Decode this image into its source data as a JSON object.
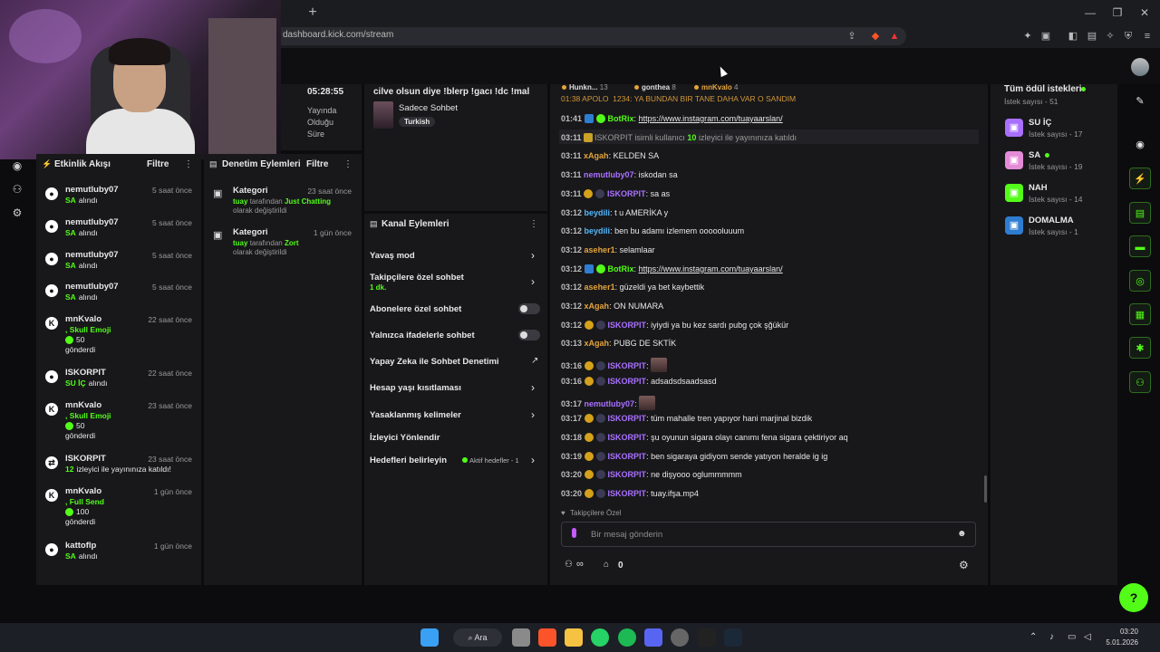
{
  "browser": {
    "url": "dashboard.kick.com/stream",
    "new_tab": "+",
    "win_min": "—",
    "win_max": "❐",
    "win_close": "✕"
  },
  "uptime": {
    "time": "05:28:55",
    "label_1": "Yayında",
    "label_2": "Olduğu",
    "label_3": "Süre"
  },
  "stream_info": {
    "title": "cilve olsun diye !blerp !gacı !dc !mal",
    "category": "Sadece Sohbet",
    "language": "Turkish"
  },
  "top_users_strip": [
    {
      "name": "Hunkn...",
      "count": "13"
    },
    {
      "name": "gonthea",
      "count": "8"
    },
    {
      "name": "mnKvalo",
      "count": "4"
    }
  ],
  "activity": {
    "title": "Etkinlik Akışı",
    "filter": "Filtre",
    "items": [
      {
        "name": "nemutluby07",
        "time": "5 saat önce",
        "detail_strong": "SA",
        "detail": "alındı",
        "icon": "kick-icon"
      },
      {
        "name": "nemutluby07",
        "time": "5 saat önce",
        "detail_strong": "SA",
        "detail": "alındı",
        "icon": "kick-icon"
      },
      {
        "name": "nemutluby07",
        "time": "5 saat önce",
        "detail_strong": "SA",
        "detail": "alındı",
        "icon": "kick-icon"
      },
      {
        "name": "nemutluby07",
        "time": "5 saat önce",
        "detail_strong": "SA",
        "detail": "alındı",
        "icon": "kick-icon"
      },
      {
        "name": "mnKvalo",
        "time": "22 saat önce",
        "detail_strong": ", Skull Emoji",
        "amount": "50",
        "detail": "gönderdi",
        "icon": "k-icon"
      },
      {
        "name": "ISKORPIT",
        "time": "22 saat önce",
        "detail_strong": "SU İÇ",
        "detail": "alındı",
        "icon": "kick-icon"
      },
      {
        "name": "mnKvalo",
        "time": "23 saat önce",
        "detail_strong": ", Skull Emoji",
        "amount": "50",
        "detail": "gönderdi",
        "icon": "k-icon"
      },
      {
        "name": "ISKORPIT",
        "time": "23 saat önce",
        "detail_strong": "12",
        "detail": "izleyici ile yayınınıza katıldı!",
        "icon": "raid-icon"
      },
      {
        "name": "mnKvalo",
        "time": "1 gün önce",
        "detail_strong": ", Full Send",
        "amount": "100",
        "detail": "gönderdi",
        "icon": "k-icon"
      },
      {
        "name": "kattoflp",
        "time": "1 gün önce",
        "detail_strong": "SA",
        "detail": "alındı",
        "icon": "kick-icon"
      }
    ]
  },
  "moderation": {
    "title": "Denetim Eylemleri",
    "filter": "Filtre",
    "items": [
      {
        "title": "Kategori",
        "time": "23 saat önce",
        "actor": "tuay",
        "mid": "tarafından",
        "value": "Just Chatting",
        "tail": "olarak değiştirildi"
      },
      {
        "title": "Kategori",
        "time": "1 gün önce",
        "actor": "tuay",
        "mid": "tarafından",
        "value": "Zort",
        "tail": "olarak değiştirildi"
      }
    ]
  },
  "channel_actions": {
    "title": "Kanal Eylemleri",
    "slow_mode": "Yavaş mod",
    "followers_only": "Takipçilere özel sohbet",
    "followers_only_value": "1 dk.",
    "subs_only": "Abonelere özel sohbet",
    "emotes_only": "Yalnızca ifadelerle sohbet",
    "ai_moderation": "Yapay Zeka ile Sohbet Denetimi",
    "age_restriction": "Hesap yaşı kısıtlaması",
    "banned_words": "Yasaklanmış kelimeler",
    "viewer_redirect": "İzleyici Yönlendir",
    "goals": "Hedefleri belirleyin",
    "goals_status": "Aktif hedefler - 1"
  },
  "chat": {
    "partial_top": "01:38  APOLO_1234: YA BUNDAN BIR TANE DAHA VAR O SANDIM",
    "messages": [
      {
        "time": "01:41",
        "user": "BotRix",
        "color": "#53fc18",
        "badges": [
          "bot",
          "verified"
        ],
        "text": "https://www.instagram.com/tuayaarslan/",
        "link": true
      },
      {
        "time": "03:11",
        "system": true,
        "text_1": "ISKORPIT isimli kullanıcı",
        "num": "10",
        "text_2": "izleyici ile yayınınıza katıldı"
      },
      {
        "time": "03:11",
        "user": "xAgah",
        "color": "#e3a43a",
        "badges": [],
        "text": "KELDEN SA"
      },
      {
        "time": "03:11",
        "user": "nemutluby07",
        "color": "#a970ff",
        "badges": [],
        "text": "iskodan sa"
      },
      {
        "time": "03:11",
        "user": "ISKORPIT",
        "color": "#a970ff",
        "badges": [
          "gold",
          "moon"
        ],
        "text": "sa as"
      },
      {
        "time": "03:12",
        "user": "beydili",
        "color": "#53b7fc",
        "badges": [],
        "text": "t u AMERİKA y"
      },
      {
        "time": "03:12",
        "user": "beydili",
        "color": "#53b7fc",
        "badges": [],
        "text": "ben bu adamı izlemem oooooluuum"
      },
      {
        "time": "03:12",
        "user": "aseher1",
        "color": "#e3a43a",
        "badges": [],
        "text": "selamlaar"
      },
      {
        "time": "03:12",
        "user": "BotRix",
        "color": "#53fc18",
        "badges": [
          "bot",
          "verified"
        ],
        "text": "https://www.instagram.com/tuayaarslan/",
        "link": true
      },
      {
        "time": "03:12",
        "user": "aseher1",
        "color": "#e3a43a",
        "badges": [],
        "text": "güzeldi ya bet kaybettik"
      },
      {
        "time": "03:12",
        "user": "xAgah",
        "color": "#e3a43a",
        "badges": [],
        "text": "ON NUMARA"
      },
      {
        "time": "03:12",
        "user": "ISKORPIT",
        "color": "#a970ff",
        "badges": [
          "gold",
          "moon"
        ],
        "text": "iyiydi ya bu kez sardı pubg çok şğükür"
      },
      {
        "time": "03:13",
        "user": "xAgah",
        "color": "#e3a43a",
        "badges": [],
        "text": "PUBG DE SKTİK"
      },
      {
        "time": "03:16",
        "user": "ISKORPIT",
        "color": "#a970ff",
        "badges": [
          "gold",
          "moon"
        ],
        "text": "",
        "emote": true
      },
      {
        "time": "03:16",
        "user": "ISKORPIT",
        "color": "#a970ff",
        "badges": [
          "gold",
          "moon"
        ],
        "text": "adsadsdsaadsasd"
      },
      {
        "time": "03:17",
        "user": "nemutluby07",
        "color": "#a970ff",
        "badges": [],
        "text": "",
        "emote": true
      },
      {
        "time": "03:17",
        "user": "ISKORPIT",
        "color": "#a970ff",
        "badges": [
          "gold",
          "moon"
        ],
        "text": "tüm mahalle tren yapıyor hani marjinal bizdik"
      },
      {
        "time": "03:18",
        "user": "ISKORPIT",
        "color": "#a970ff",
        "badges": [
          "gold",
          "moon"
        ],
        "text": "şu oyunun sigara olayı canımı fena sigara çektiriyor aq"
      },
      {
        "time": "03:19",
        "user": "ISKORPIT",
        "color": "#a970ff",
        "badges": [
          "gold",
          "moon"
        ],
        "text": "ben sigaraya gidiyom sende yatıyon heralde ig ig"
      },
      {
        "time": "03:20",
        "user": "ISKORPIT",
        "color": "#a970ff",
        "badges": [
          "gold",
          "moon"
        ],
        "text": "ne dişyooo oglummmmm"
      },
      {
        "time": "03:20",
        "user": "ISKORPIT",
        "color": "#a970ff",
        "badges": [
          "gold",
          "moon"
        ],
        "text": "tuay.ifşa.mp4"
      }
    ],
    "mode_label": "Takipçilere Özel",
    "input_placeholder": "Bir mesaj gönderin",
    "viewer_count": "∞",
    "points": "0"
  },
  "rewards": {
    "title": "Tüm ödül istekleri",
    "items": [
      {
        "name": "SU İÇ",
        "count": "İstek sayısı - 17",
        "color": "#a970ff",
        "dot": false
      },
      {
        "name": "SA",
        "count": "İstek sayısı - 19",
        "color": "#e48bd8",
        "dot": true
      },
      {
        "name": "NAH",
        "count": "İstek sayısı - 14",
        "color": "#53fc18",
        "dot": false
      },
      {
        "name": "DOMALMA",
        "count": "İstek sayısı - 1",
        "color": "#2f7dd1",
        "dot": false
      }
    ],
    "all_count": "İstek sayısı - 51"
  },
  "taskbar": {
    "search": "Ara",
    "time": "03:20",
    "date": "5.01.2026"
  }
}
